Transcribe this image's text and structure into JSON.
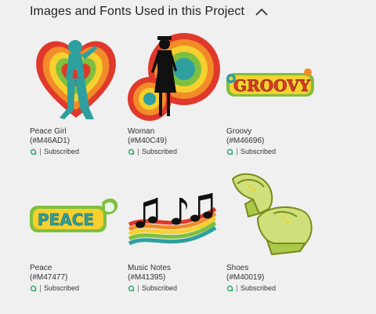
{
  "section": {
    "title": "Images and Fonts Used in this Project",
    "toggle_icon": "chevron-up-icon"
  },
  "items": [
    {
      "title": "Peace Girl",
      "code": "(#M46AD1)",
      "status": "Subscribed",
      "icon": "access-icon"
    },
    {
      "title": "Woman",
      "code": "(#M40C49)",
      "status": "Subscribed",
      "icon": "access-icon"
    },
    {
      "title": "Groovy",
      "code": "(#M46696)",
      "status": "Subscribed",
      "icon": "access-icon"
    },
    {
      "title": "Peace",
      "code": "(#M47477)",
      "status": "Subscribed",
      "icon": "access-icon"
    },
    {
      "title": "Music Notes",
      "code": "(#M41395)",
      "status": "Subscribed",
      "icon": "access-icon"
    },
    {
      "title": "Shoes",
      "code": "(#M40019)",
      "status": "Subscribed",
      "icon": "access-icon"
    }
  ],
  "images": {
    "groovy_text": "GROOVY",
    "peace_text": "PEACE"
  },
  "colors": {
    "access_green": "#2fa86a",
    "teal": "#2e9f9f",
    "red": "#e0392b",
    "orange": "#f28c28",
    "yellow": "#f6d02f",
    "green": "#7fbf3f"
  }
}
